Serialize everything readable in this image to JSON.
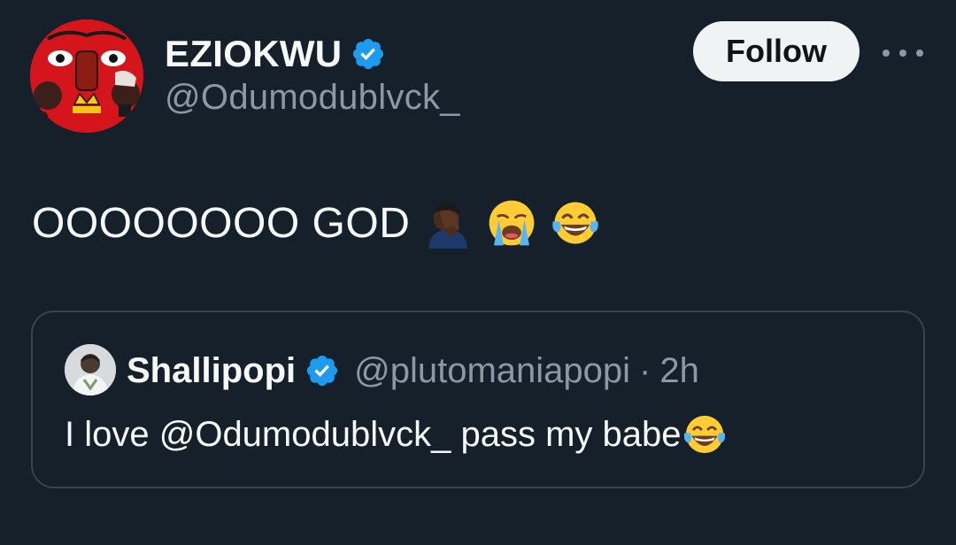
{
  "author": {
    "display_name": "EZIOKWU",
    "handle": "@Odumodublvck_",
    "verified": true
  },
  "actions": {
    "follow_label": "Follow"
  },
  "tweet": {
    "text": "OOOOOOOO GOD",
    "emojis": [
      "man-facepalming-dark-skin",
      "loudly-crying-face",
      "face-with-tears-of-joy"
    ]
  },
  "quote": {
    "display_name": "Shallipopi",
    "handle": "@plutomaniapopi",
    "separator": "·",
    "time": "2h",
    "verified": true,
    "text": "I love @Odumodublvck_ pass my babe",
    "emojis": [
      "face-with-tears-of-joy"
    ]
  },
  "colors": {
    "background": "#15202b",
    "text_primary": "#f7f9f9",
    "text_secondary": "#8b98a5",
    "verified_blue": "#1d9bf0",
    "border": "#38444d",
    "follow_bg": "#eff3f4"
  }
}
